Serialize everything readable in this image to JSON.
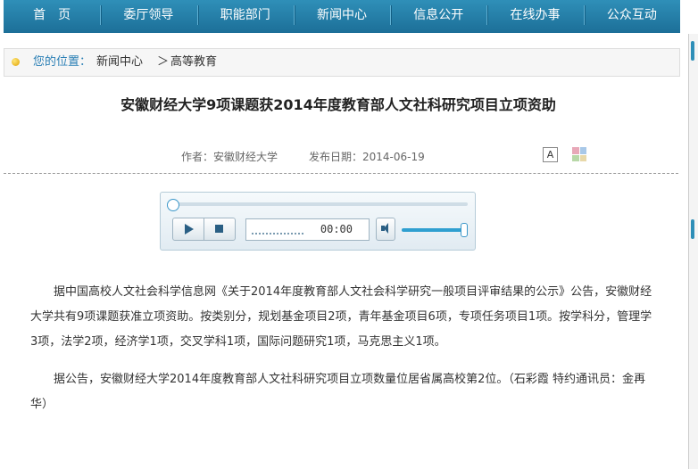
{
  "nav": [
    "首　页",
    "委厅领导",
    "职能部门",
    "新闻中心",
    "信息公开",
    "在线办事",
    "公众互动"
  ],
  "breadcrumb": {
    "label": "您的位置：",
    "level1": "新闻中心",
    "separator": "＞",
    "level2": "高等教育"
  },
  "article": {
    "title": "安徽财经大学9项课题获2014年度教育部人文社科研究项目立项资助",
    "author": "作者：安徽财经大学",
    "date": "发布日期：2014-06-19",
    "font_size_label": "A",
    "paragraphs": [
      "据中国高校人文社会科学信息网《关于2014年度教育部人文社会科学研究一般项目评审结果的公示》公告，安徽财经大学共有9项课题获准立项资助。按类别分，规划基金项目2项，青年基金项目6项，专项任务项目1项。按学科分，管理学3项，法学2项，经济学1项，交叉学科1项，国际问题研究1项，马克思主义1项。",
      "据公告，安徽财经大学2014年度教育部人文社科研究项目立项数量位居省属高校第2位。（石彩霞 特约通讯员：金再华）"
    ]
  },
  "player": {
    "time": "00:00",
    "progress": 0,
    "volume": 1.0
  },
  "colors": {
    "nav": "#2f8fb8",
    "accent": "#2a7fb5"
  }
}
